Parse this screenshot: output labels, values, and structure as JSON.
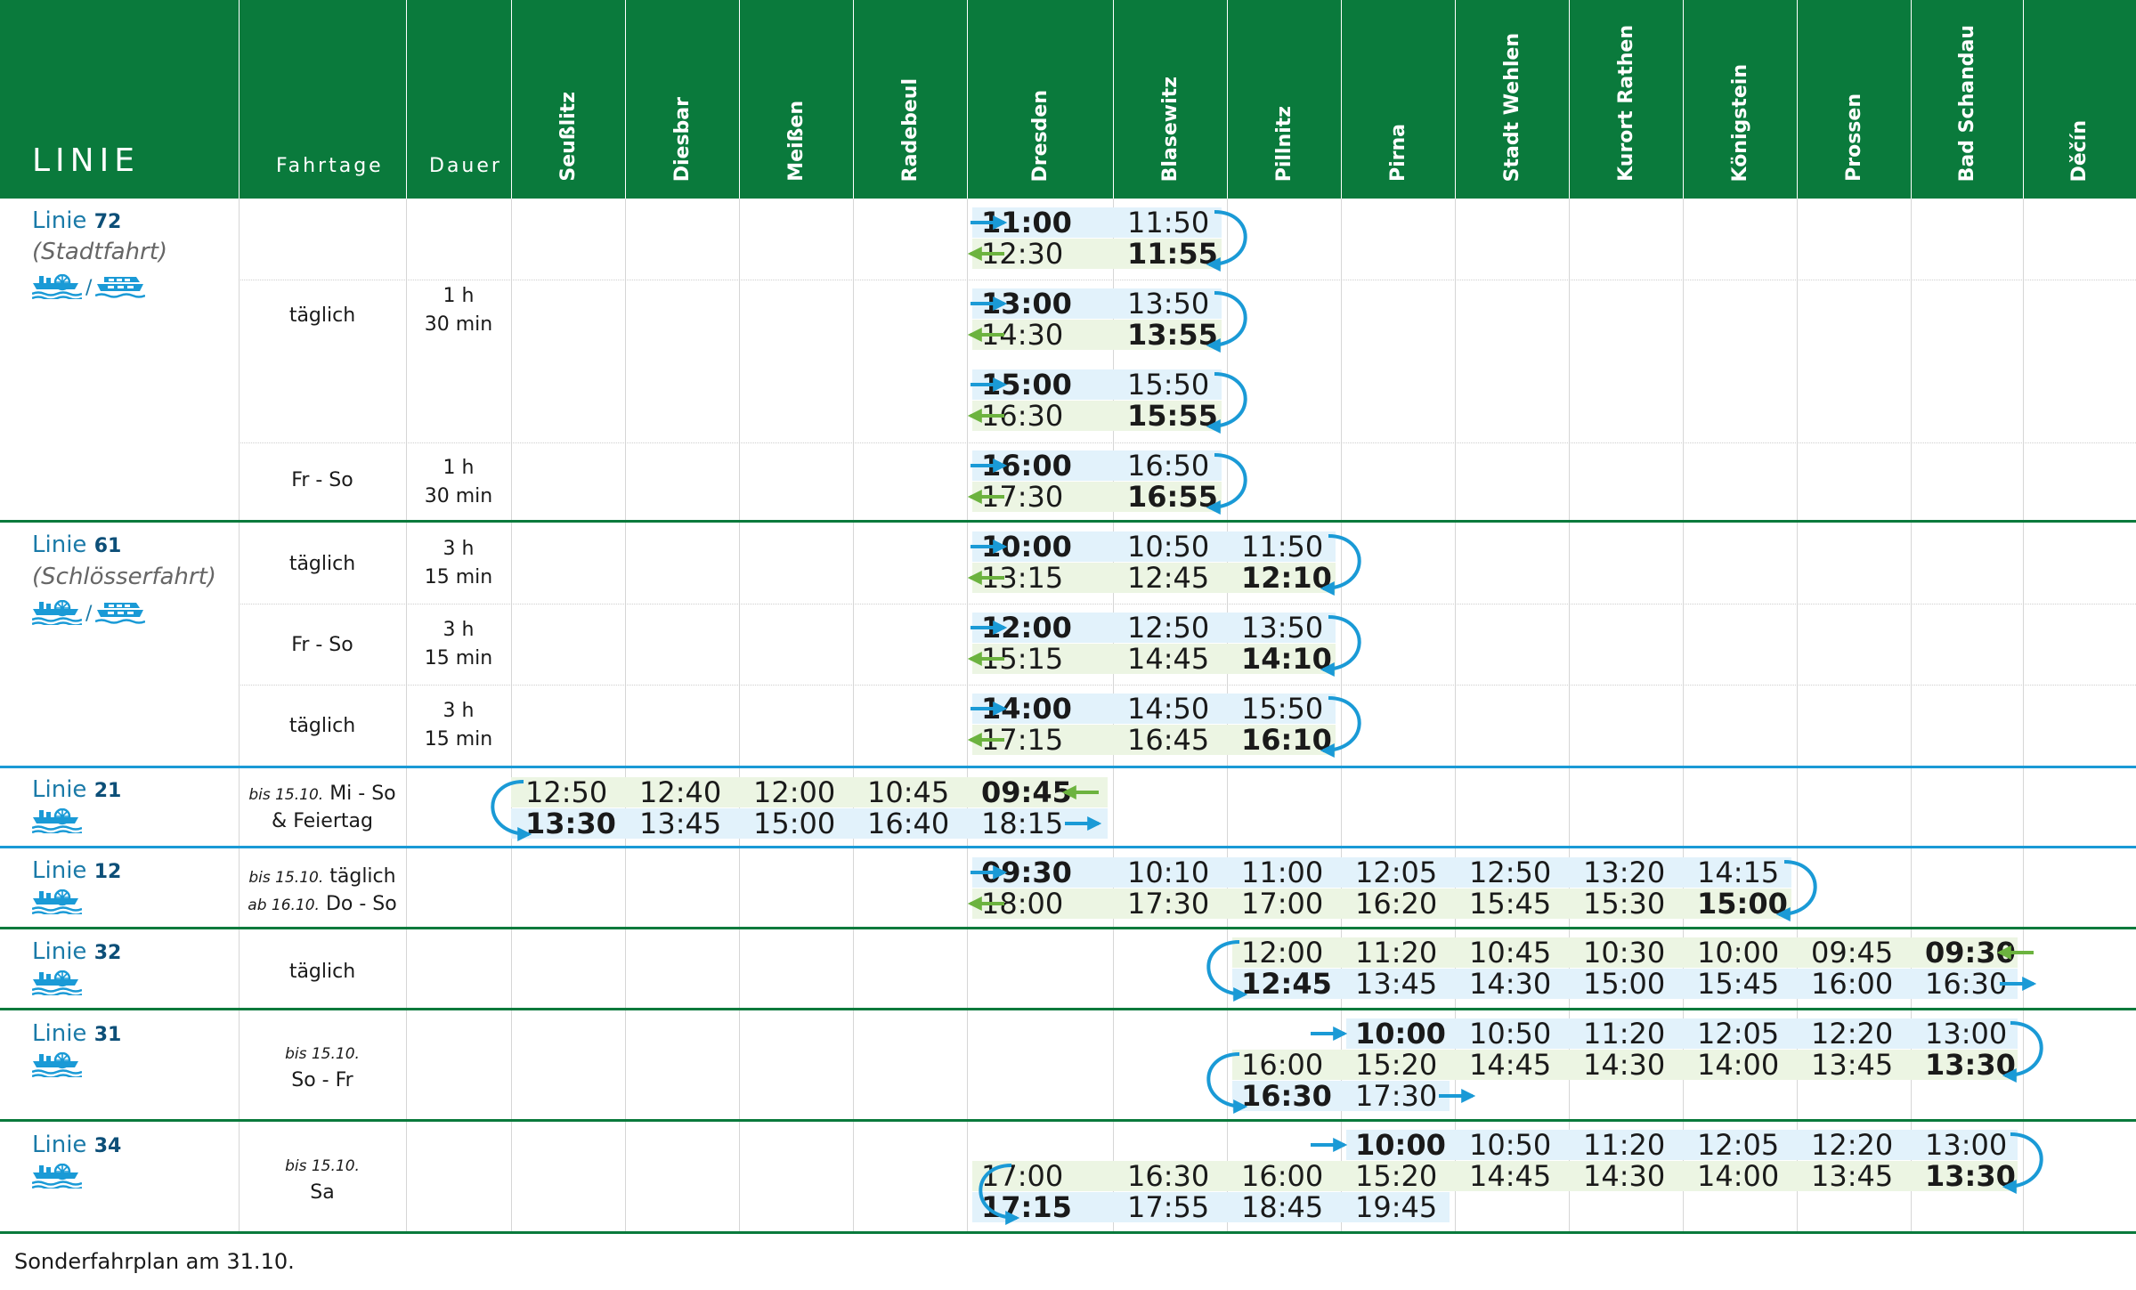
{
  "header": {
    "title": "LINIE",
    "fahrtage": "Fahrtage",
    "dauer": "Dauer",
    "stations": [
      "Seußlitz",
      "Diesbar",
      "Meißen",
      "Radebeul",
      "Dresden",
      "Blasewitz",
      "Pillnitz",
      "Pirna",
      "Stadt Wehlen",
      "Kurort Rathen",
      "Königstein",
      "Prossen",
      "Bad Schandau",
      "Děčín"
    ]
  },
  "colors": {
    "header_green": "#0a7a3c",
    "arrow_blue": "#1a9ad6",
    "arrow_green": "#6cb33f",
    "band_blue": "#e2f2fb",
    "band_green": "#ecf5e3",
    "line_blue": "#1a9ad6",
    "line_green": "#0a7a3c"
  },
  "icons": [
    "arrow-right-icon",
    "arrow-left-icon",
    "turnaround-icon",
    "paddle-steamer-icon",
    "motor-ship-icon"
  ],
  "sections": [
    {
      "name": "Linie",
      "num": "72",
      "sub": "(Stadtfahrt)",
      "icon": "paddle-steamer-icon",
      "icon2": "motor-ship-icon",
      "slash": "/",
      "groups": [
        {
          "days": "täglich",
          "dur1": "1 h",
          "dur2": "30 min",
          "trips": [
            {
              "out": [
                "11:00",
                "11:50"
              ],
              "ret": [
                "12:30",
                "11:55"
              ]
            },
            {
              "out": [
                "13:00",
                "13:50"
              ],
              "ret": [
                "14:30",
                "13:55"
              ]
            },
            {
              "out": [
                "15:00",
                "15:50"
              ],
              "ret": [
                "16:30",
                "15:55"
              ]
            }
          ]
        },
        {
          "days": "Fr - So",
          "dur1": "1 h",
          "dur2": "30 min",
          "trips": [
            {
              "out": [
                "16:00",
                "16:50"
              ],
              "ret": [
                "17:30",
                "16:55"
              ]
            }
          ]
        }
      ]
    },
    {
      "name": "Linie",
      "num": "61",
      "sub": "(Schlösserfahrt)",
      "icon": "paddle-steamer-icon",
      "icon2": "motor-ship-icon",
      "slash": "/",
      "groups": [
        {
          "days": "täglich",
          "dur1": "3 h",
          "dur2": "15 min",
          "trips": [
            {
              "out": [
                "10:00",
                "10:50",
                "11:50"
              ],
              "ret": [
                "13:15",
                "12:45",
                "12:10"
              ]
            }
          ]
        },
        {
          "days": "Fr - So",
          "dur1": "3 h",
          "dur2": "15 min",
          "trips": [
            {
              "out": [
                "12:00",
                "12:50",
                "13:50"
              ],
              "ret": [
                "15:15",
                "14:45",
                "14:10"
              ]
            }
          ]
        },
        {
          "days": "täglich",
          "dur1": "3 h",
          "dur2": "15 min",
          "trips": [
            {
              "out": [
                "14:00",
                "14:50",
                "15:50"
              ],
              "ret": [
                "17:15",
                "16:45",
                "16:10"
              ]
            }
          ]
        }
      ]
    },
    {
      "name": "Linie",
      "num": "21",
      "icon": "paddle-steamer-icon",
      "days_pre": "bis 15.10.",
      "days1": "Mi - So",
      "days2": "& Feiertag",
      "row1": [
        "12:50",
        "12:40",
        "12:00",
        "10:45",
        "09:45"
      ],
      "row2": [
        "13:30",
        "13:45",
        "15:00",
        "16:40",
        "18:15"
      ]
    },
    {
      "name": "Linie",
      "num": "12",
      "icon": "paddle-steamer-icon",
      "days_pre1": "bis 15.10.",
      "days1": "täglich",
      "days_pre2": "ab 16.10.",
      "days2": "Do - So",
      "row1": [
        "09:30",
        "10:10",
        "11:00",
        "12:05",
        "12:50",
        "13:20",
        "14:15"
      ],
      "row2": [
        "18:00",
        "17:30",
        "17:00",
        "16:20",
        "15:45",
        "15:30",
        "15:00"
      ]
    },
    {
      "name": "Linie",
      "num": "32",
      "icon": "paddle-steamer-icon",
      "days": "täglich",
      "row1": [
        "12:00",
        "11:20",
        "10:45",
        "10:30",
        "10:00",
        "09:45",
        "09:30"
      ],
      "row2": [
        "12:45",
        "13:45",
        "14:30",
        "15:00",
        "15:45",
        "16:00",
        "16:30"
      ]
    },
    {
      "name": "Linie",
      "num": "31",
      "icon": "paddle-steamer-icon",
      "days_pre": "bis 15.10.",
      "days": "So - Fr",
      "row1": [
        "10:00",
        "10:50",
        "11:20",
        "12:05",
        "12:20",
        "13:00"
      ],
      "row2": [
        "16:00",
        "15:20",
        "14:45",
        "14:30",
        "14:00",
        "13:45",
        "13:30"
      ],
      "row3": [
        "16:30",
        "17:30"
      ]
    },
    {
      "name": "Linie",
      "num": "34",
      "icon": "paddle-steamer-icon",
      "days_pre": "bis 15.10.",
      "days": "Sa",
      "row1": [
        "10:00",
        "10:50",
        "11:20",
        "12:05",
        "12:20",
        "13:00"
      ],
      "row2": [
        "17:00",
        "16:30",
        "16:00",
        "15:20",
        "14:45",
        "14:30",
        "14:00",
        "13:45",
        "13:30"
      ],
      "row3": [
        "17:15",
        "17:55",
        "18:45",
        "19:45"
      ]
    }
  ],
  "footer": "Sonderfahrplan am 31.10."
}
